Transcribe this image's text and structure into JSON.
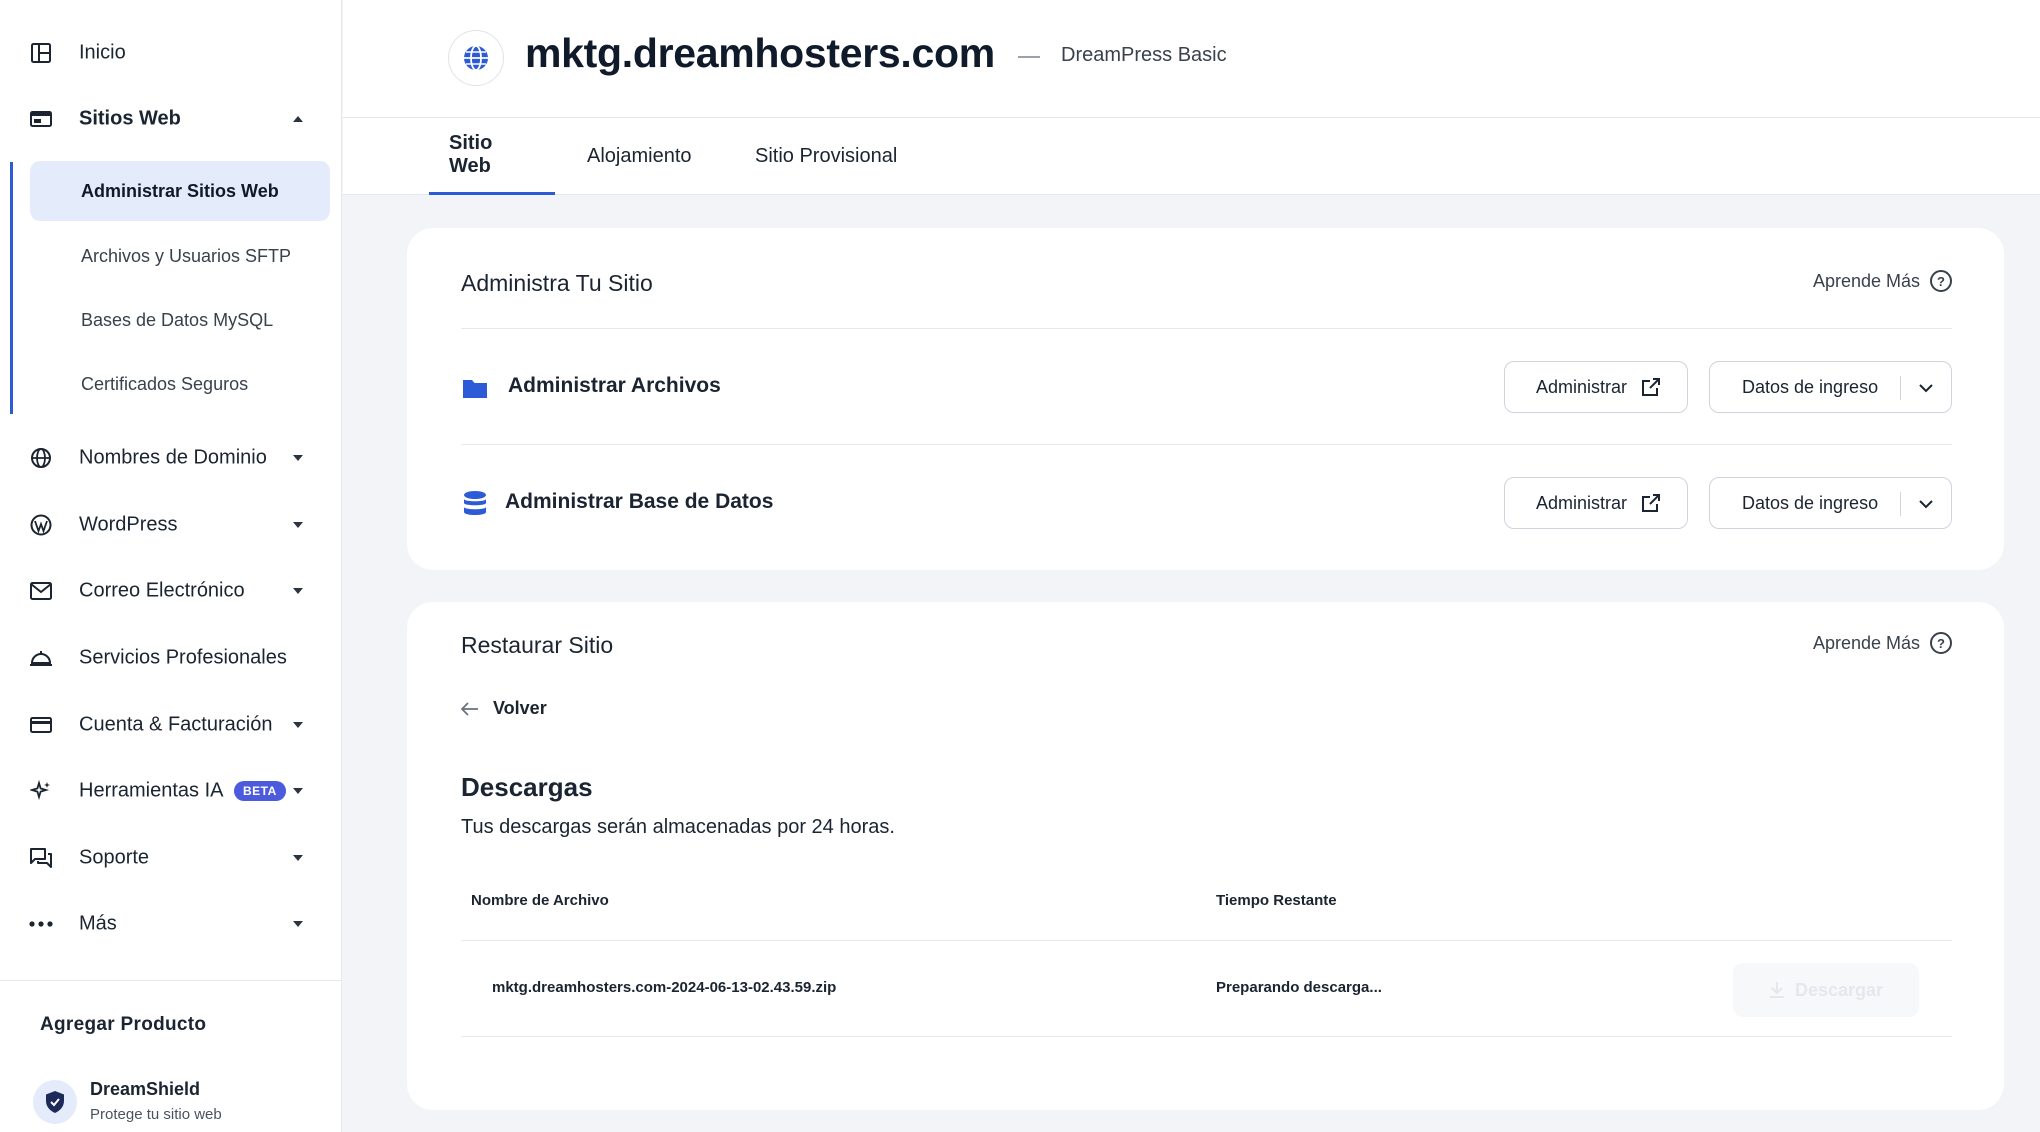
{
  "sidebar": {
    "items": [
      {
        "label": "Inicio"
      },
      {
        "label": "Sitios Web"
      },
      {
        "label": "Nombres de Dominio"
      },
      {
        "label": "WordPress"
      },
      {
        "label": "Correo Electrónico"
      },
      {
        "label": "Servicios Profesionales"
      },
      {
        "label": "Cuenta & Facturación"
      },
      {
        "label": "Herramientas IA",
        "badge": "BETA"
      },
      {
        "label": "Soporte"
      },
      {
        "label": "Más"
      }
    ],
    "subitems": [
      {
        "label": "Administrar Sitios Web"
      },
      {
        "label": "Archivos y Usuarios SFTP"
      },
      {
        "label": "Bases de Datos MySQL"
      },
      {
        "label": "Certificados Seguros"
      }
    ],
    "add_product": "Agregar Producto",
    "promo": {
      "name": "DreamShield",
      "subtitle": "Protege tu sitio web"
    }
  },
  "header": {
    "site": "mktg.dreamhosters.com",
    "plan": "DreamPress Basic"
  },
  "tabs": [
    {
      "label": "Sitio Web"
    },
    {
      "label": "Alojamiento"
    },
    {
      "label": "Sitio Provisional"
    }
  ],
  "manage_card": {
    "title": "Administra Tu Sitio",
    "learn_more": "Aprende Más",
    "rows": [
      {
        "label": "Administrar Archivos",
        "manage": "Administrar",
        "login": "Datos de ingreso"
      },
      {
        "label": "Administrar Base de Datos",
        "manage": "Administrar",
        "login": "Datos de ingreso"
      }
    ]
  },
  "restore_card": {
    "title": "Restaurar Sitio",
    "learn_more": "Aprende Más",
    "back": "Volver",
    "downloads_title": "Descargas",
    "downloads_desc": "Tus descargas serán almacenadas por 24 horas.",
    "columns": [
      "Nombre de Archivo",
      "Tiempo Restante"
    ],
    "files": [
      {
        "name": "mktg.dreamhosters.com-2024-06-13-02.43.59.zip",
        "status": "Preparando descarga...",
        "action": "Descargar"
      }
    ]
  },
  "colors": {
    "accent": "#2d5bd7",
    "beta": "#4b5bdc",
    "active_bg": "#e4ebfa"
  }
}
